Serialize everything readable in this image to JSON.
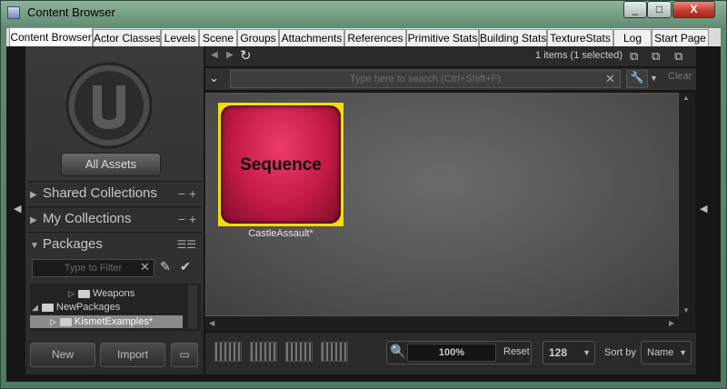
{
  "window": {
    "title": "Content Browser",
    "min": "_",
    "max": "□",
    "close": "X"
  },
  "tabs": [
    "Content Browser",
    "Actor Classes",
    "Levels",
    "Scene",
    "Groups",
    "Attachments",
    "References",
    "Primitive Stats",
    "Building Stats",
    "TextureStats",
    "Log",
    "Start Page"
  ],
  "left": {
    "all_assets": "All Assets",
    "shared_collections": "Shared Collections",
    "my_collections": "My Collections",
    "packages": "Packages",
    "filter_placeholder": "Type to Filter",
    "tree": [
      "Weapons",
      "NewPackages",
      "KismetExamples*"
    ],
    "new": "New",
    "import": "Import"
  },
  "toolbar": {
    "count": "1 items (1 selected)",
    "search_placeholder": "Type here to search  (Ctrl+Shift+F)",
    "clear": "Clear"
  },
  "asset": {
    "thumb_label": "Sequence",
    "name": "CastleAssault*"
  },
  "bottom": {
    "zoom": "100%",
    "reset": "Reset",
    "size": "128",
    "sort_by": "Sort by",
    "sort_value": "Name"
  },
  "colors": {
    "selection": "#f0e000",
    "thumb": "#c31a45"
  }
}
